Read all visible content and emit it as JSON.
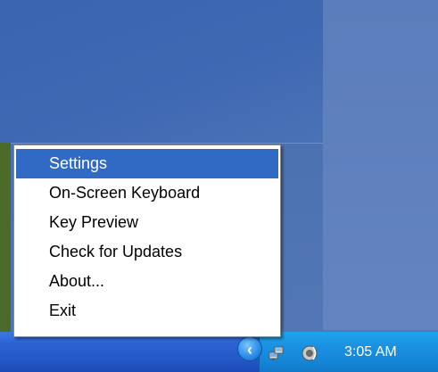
{
  "context_menu": {
    "items": [
      {
        "label": "Settings",
        "highlighted": true
      },
      {
        "label": "On-Screen Keyboard",
        "highlighted": false
      },
      {
        "label": "Key Preview",
        "highlighted": false
      },
      {
        "label": "Check for Updates",
        "highlighted": false
      },
      {
        "label": "About...",
        "highlighted": false
      },
      {
        "label": "Exit",
        "highlighted": false
      }
    ]
  },
  "taskbar": {
    "clock": "3:05 AM",
    "tray_icons": [
      {
        "name": "show-hidden-icons-chevron-icon",
        "glyph": "‹"
      },
      {
        "name": "network-icon"
      },
      {
        "name": "volume-speaker-icon"
      }
    ]
  },
  "colors": {
    "menu_highlight": "#316ac5",
    "taskbar_blue": "#2457c8",
    "tray_blue": "#1587d8",
    "desktop_blue": "#4a6fae"
  }
}
